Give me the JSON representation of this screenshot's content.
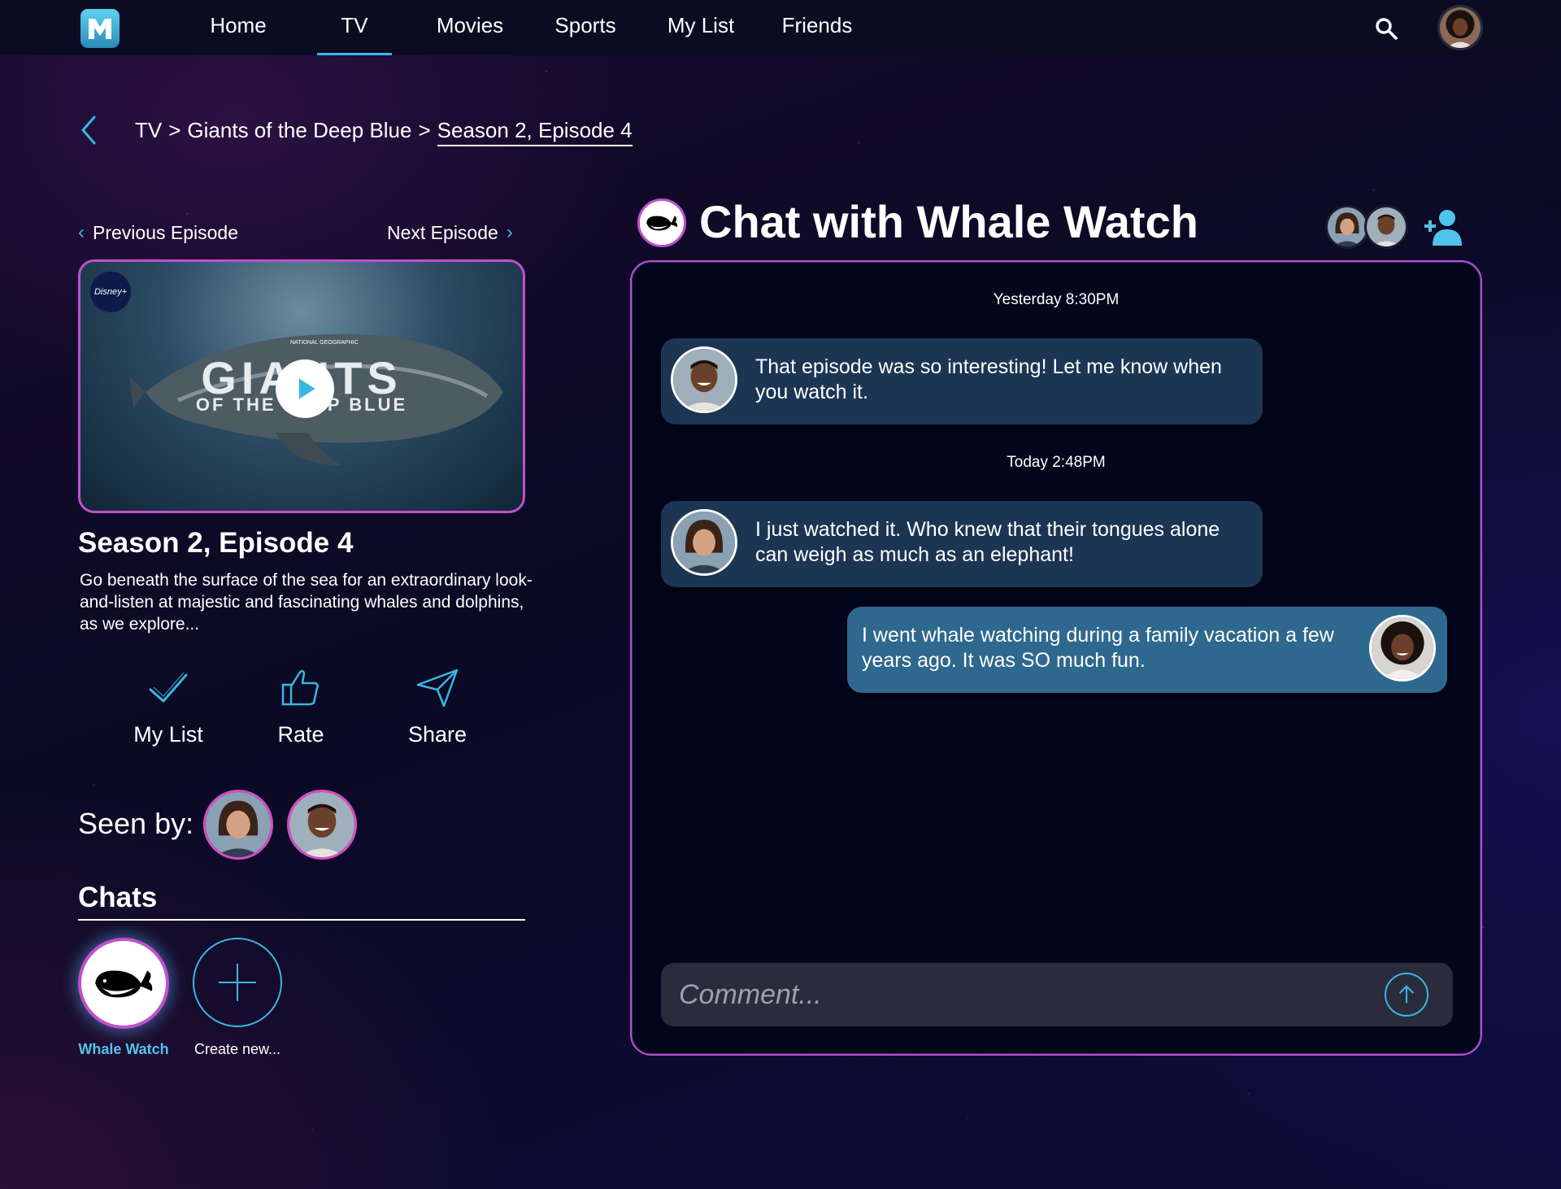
{
  "nav": {
    "items": [
      {
        "label": "Home"
      },
      {
        "label": "TV",
        "active": true
      },
      {
        "label": "Movies"
      },
      {
        "label": "Sports"
      },
      {
        "label": "My List"
      },
      {
        "label": "Friends"
      }
    ],
    "search_icon": "search-icon",
    "accent_color": "#3ab6e3"
  },
  "breadcrumb": {
    "items": [
      "TV",
      "Giants of the Deep Blue",
      "Season 2, Episode 4"
    ],
    "separator": ">"
  },
  "episode_nav": {
    "previous_label": "Previous Episode",
    "next_label": "Next Episode"
  },
  "thumbnail": {
    "title_line1": "GIANTS",
    "title_line2": "OF THE DEEP BLUE",
    "badge": "Disney+",
    "publisher_tag": "NATIONAL GEOGRAPHIC"
  },
  "episode": {
    "title": "Season 2, Episode 4",
    "description": "Go beneath the surface of the sea for an extraordinary look-and-listen at majestic and fascinating whales and dolphins, as we explore..."
  },
  "actions": {
    "mylist_label": "My List",
    "rate_label": "Rate",
    "share_label": "Share"
  },
  "seen_by": {
    "label": "Seen by:"
  },
  "chats": {
    "heading": "Chats",
    "items": [
      {
        "label": "Whale Watch"
      },
      {
        "label": "Create new..."
      }
    ]
  },
  "chat": {
    "title": "Chat with Whale Watch",
    "messages": [
      {
        "timestamp": "Yesterday 8:30PM",
        "text": "That episode was so interesting! Let me know when you watch it.",
        "direction": "in"
      },
      {
        "timestamp": "Today 2:48PM",
        "text": "I just watched it. Who knew that their tongues alone can weigh as much as an elephant!",
        "direction": "in"
      },
      {
        "text": "I went whale watching during a family vacation a few years ago. It was SO much fun.",
        "direction": "out"
      }
    ],
    "comment_placeholder": "Comment...",
    "comment_value": "",
    "incoming_bubble_color": "#1c3553",
    "outgoing_bubble_color": "#2e688e",
    "border_color": "#c04fcf"
  }
}
